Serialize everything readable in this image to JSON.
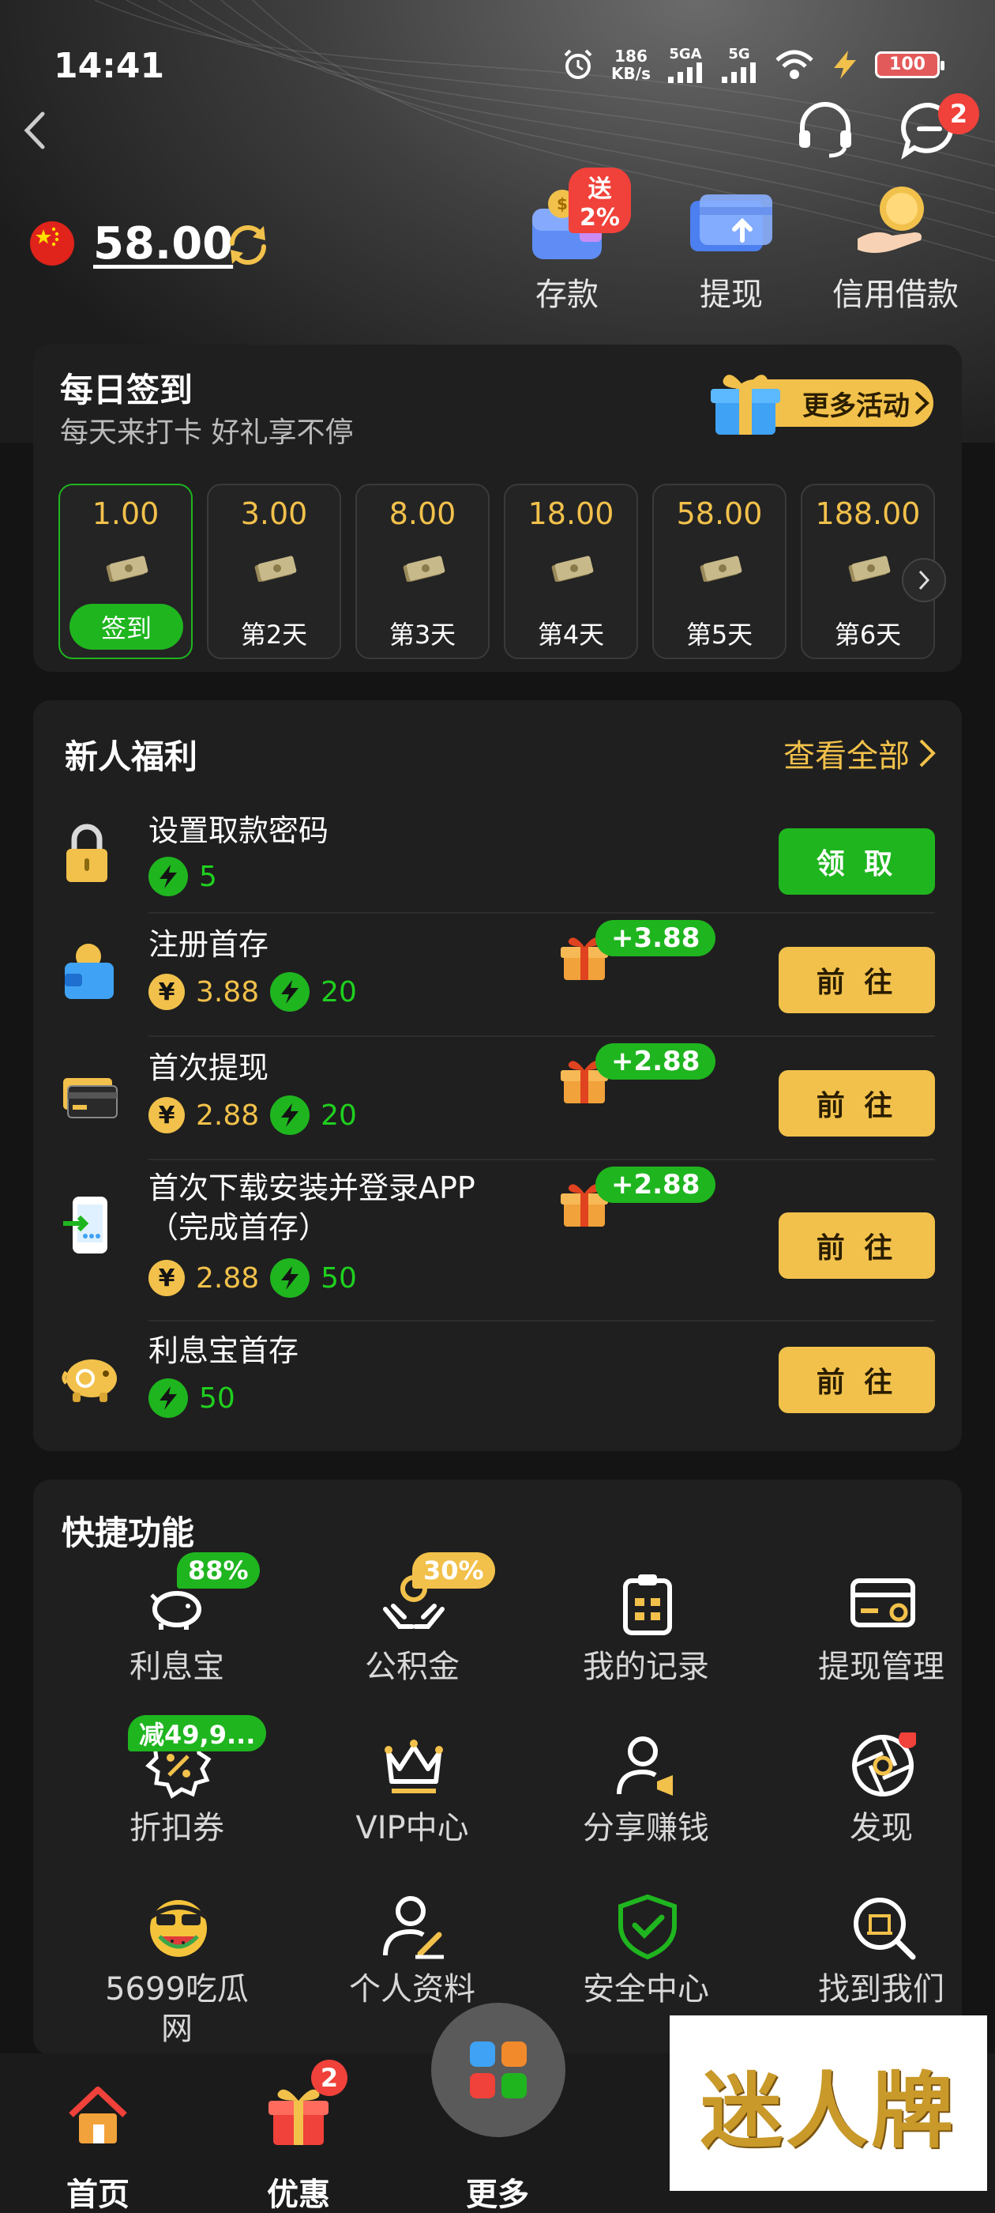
{
  "status_bar": {
    "time": "14:41",
    "net_speed_value": "186",
    "net_speed_unit": "KB/s",
    "signal_1": "5GA",
    "signal_2": "5G",
    "battery": "100"
  },
  "header": {
    "message_badge": "2"
  },
  "account": {
    "balance": "58.00"
  },
  "top_actions": [
    {
      "label": "存款",
      "badge": "送2%"
    },
    {
      "label": "提现"
    },
    {
      "label": "信用借款"
    }
  ],
  "daily_checkin": {
    "title": "每日签到",
    "subtitle": "每天来打卡 好礼享不停",
    "more_label": "更多活动",
    "days": [
      {
        "amount": "1.00",
        "label": "签到"
      },
      {
        "amount": "3.00",
        "label": "第2天"
      },
      {
        "amount": "8.00",
        "label": "第3天"
      },
      {
        "amount": "18.00",
        "label": "第4天"
      },
      {
        "amount": "58.00",
        "label": "第5天"
      },
      {
        "amount": "188.00",
        "label": "第6天"
      }
    ]
  },
  "newbie": {
    "title": "新人福利",
    "view_all": "查看全部",
    "tasks": [
      {
        "name": "设置取款密码",
        "energy": "5",
        "button": "领 取"
      },
      {
        "name": "注册首存",
        "coin": "3.88",
        "energy": "20",
        "bonus": "+3.88",
        "button": "前 往"
      },
      {
        "name": "首次提现",
        "coin": "2.88",
        "energy": "20",
        "bonus": "+2.88",
        "button": "前 往"
      },
      {
        "name_line1": "首次下载安装并登录APP",
        "name_line2": "（完成首存）",
        "coin": "2.88",
        "energy": "50",
        "bonus": "+2.88",
        "button": "前 往"
      },
      {
        "name": "利息宝首存",
        "energy": "50",
        "button": "前 往"
      }
    ]
  },
  "quick": {
    "title": "快捷功能",
    "items": [
      {
        "label": "利息宝",
        "badge": "88%",
        "icon": "piggy-icon"
      },
      {
        "label": "公积金",
        "badge": "30%",
        "icon": "hands-coin-icon"
      },
      {
        "label": "我的记录",
        "icon": "clipboard-icon"
      },
      {
        "label": "提现管理",
        "icon": "card-gear-icon"
      },
      {
        "label": "折扣券",
        "badge": "减49,9...",
        "icon": "discount-icon"
      },
      {
        "label": "VIP中心",
        "icon": "crown-icon"
      },
      {
        "label": "分享赚钱",
        "icon": "user-megaphone-icon"
      },
      {
        "label": "发现",
        "icon": "aperture-icon"
      },
      {
        "label_line1": "5699吃瓜",
        "label_line2": "网",
        "icon": "watermelon-emoji-icon"
      },
      {
        "label": "个人资料",
        "icon": "user-edit-icon"
      },
      {
        "label": "安全中心",
        "icon": "shield-check-icon"
      },
      {
        "label": "找到我们",
        "icon": "search-building-icon"
      }
    ]
  },
  "tabbar": {
    "tabs": [
      {
        "label": "首页"
      },
      {
        "label": "优惠",
        "badge": "2"
      },
      {
        "label": "更多"
      }
    ]
  },
  "watermark": "迷人牌",
  "colors": {
    "accent_gold": "#f2c14b",
    "accent_green": "#1fb51f",
    "badge_red": "#f0413a",
    "background": "#141414"
  }
}
